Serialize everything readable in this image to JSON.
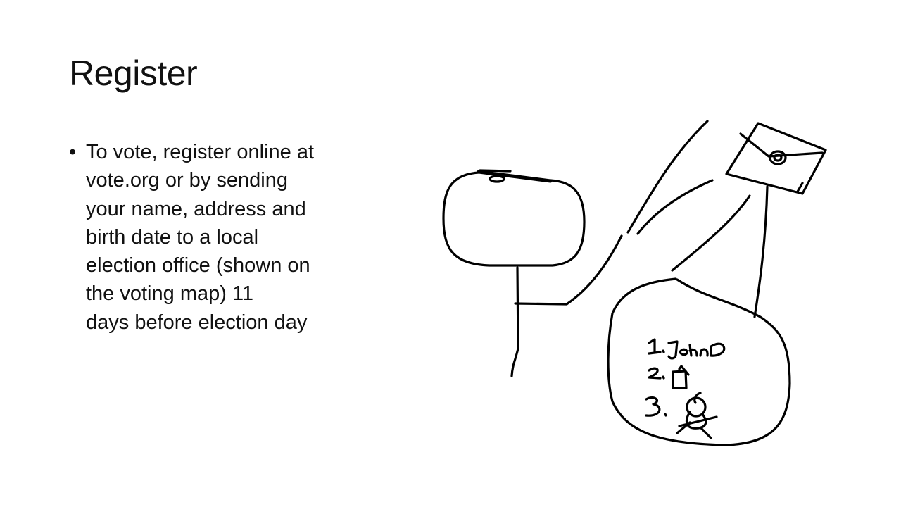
{
  "slide": {
    "title": "Register",
    "bullet_symbol": "•",
    "bullet_lines": [
      "To vote, register online at",
      "vote.org or by sending",
      "your name, address and",
      "birth date to a local",
      "election office (shown on",
      "the voting map) 11",
      "days before election day"
    ]
  },
  "drawing": {
    "list_numbers": [
      "1.",
      "2.",
      "3."
    ],
    "list_entry_1": "JohnD"
  }
}
